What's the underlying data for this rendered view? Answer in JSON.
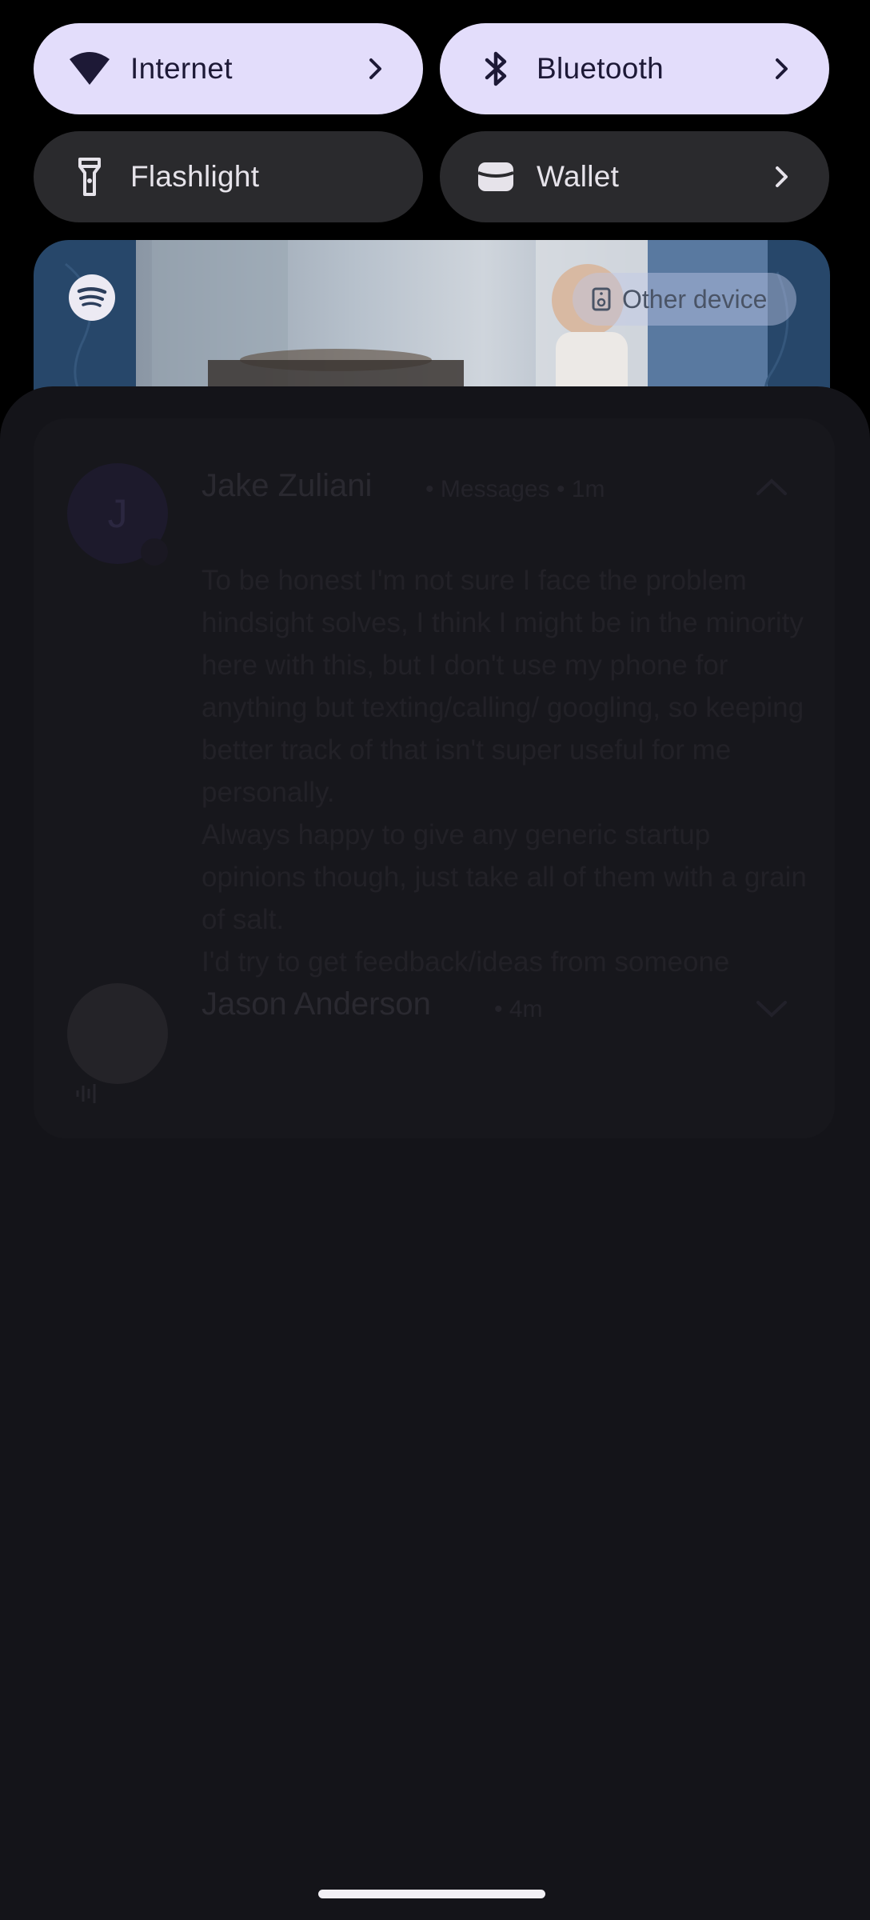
{
  "quick_settings": {
    "tiles": [
      {
        "label": "Internet",
        "state": "on",
        "icon": "wifi-icon",
        "has_chevron": true
      },
      {
        "label": "Bluetooth",
        "state": "on",
        "icon": "bluetooth-icon",
        "has_chevron": true
      },
      {
        "label": "Flashlight",
        "state": "off",
        "icon": "flashlight-icon",
        "has_chevron": false
      },
      {
        "label": "Wallet",
        "state": "off",
        "icon": "wallet-icon",
        "has_chevron": true
      }
    ]
  },
  "media": {
    "app_icon": "spotify-icon",
    "output_device_label": "Other device",
    "output_device_icon": "speaker-icon"
  },
  "notifications": [
    {
      "sender": "Jake Zuliani",
      "app": "Messages",
      "time": "1m",
      "avatar_letter": "J",
      "body": "To be honest I'm not sure I face the problem hindsight solves, I think I might be in the minority here with this, but I don't use my phone for anything but texting/calling/ googling, so keeping better track of that isn't super useful for me personally.\nAlways happy to give any generic startup opinions though, just take all of them with a grain of salt.\nI'd try to get feedback/ideas from someone"
    },
    {
      "sender": "Jason Anderson",
      "time": "4m"
    }
  ],
  "separator": "•",
  "colors": {
    "tile_on": "#e3ddfb",
    "tile_off": "#2a2a2d",
    "shade": "#141419"
  }
}
